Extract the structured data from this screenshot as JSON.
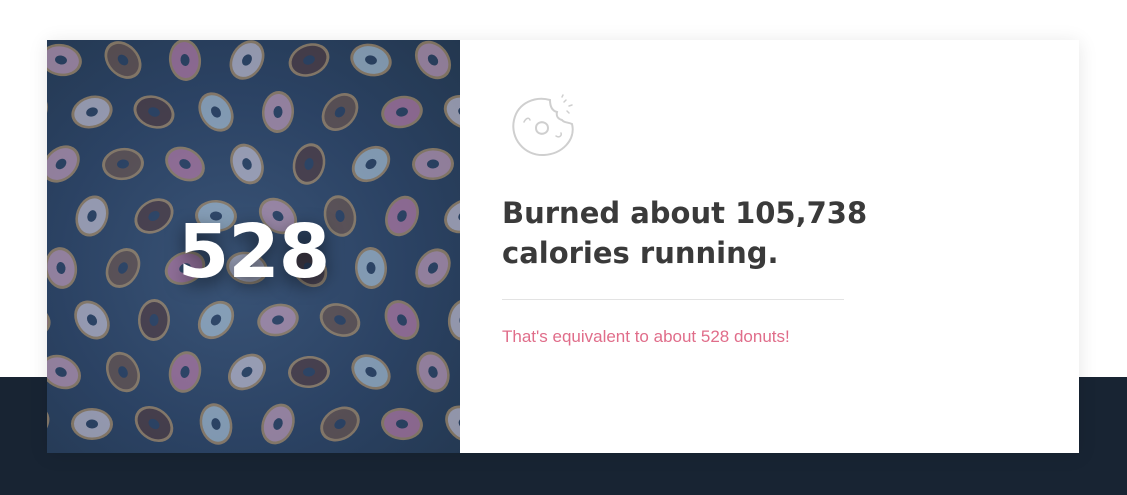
{
  "stat": {
    "value": "528",
    "headline": "Burned about 105,738 calories running.",
    "equivalent": "That's equivalent to about 528 donuts!"
  },
  "icons": {
    "card_icon": "bitten-donut-icon",
    "background": "donut-pattern"
  },
  "colors": {
    "dark_band": "#182433",
    "image_panel": "#2b4263",
    "headline_text": "#3a3a3a",
    "accent_pink": "#e06d8a",
    "divider": "#e3e3e3"
  }
}
